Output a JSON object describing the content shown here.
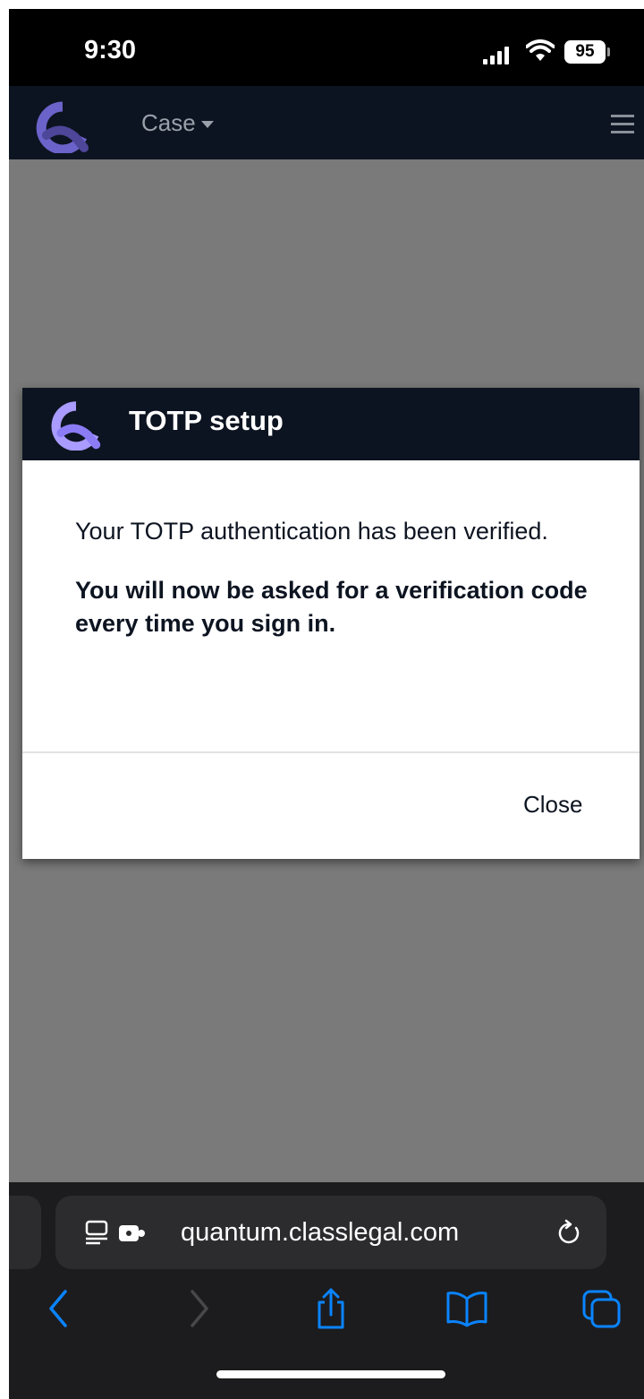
{
  "status_bar": {
    "time": "9:30",
    "battery": "95",
    "icons": [
      "signal-icon",
      "wifi-icon",
      "battery-icon"
    ]
  },
  "app_nav": {
    "logo": "quantum-logo",
    "menu_label": "Case",
    "menu_icon": "hamburger-icon"
  },
  "dialog": {
    "title": "TOTP setup",
    "message": "Your TOTP authentication has been verified.",
    "notice": "You will now be asked for a verification code every time you sign in.",
    "close_label": "Close"
  },
  "browser": {
    "url": "quantum.classlegal.com",
    "toolbar": [
      "back-icon",
      "forward-icon",
      "share-icon",
      "bookmarks-icon",
      "tabs-icon"
    ]
  },
  "colors": {
    "accent": "#8b7cf6",
    "header_bg": "#0d1421",
    "overlay": "#7a7a7a",
    "browser_accent": "#0a84ff"
  }
}
